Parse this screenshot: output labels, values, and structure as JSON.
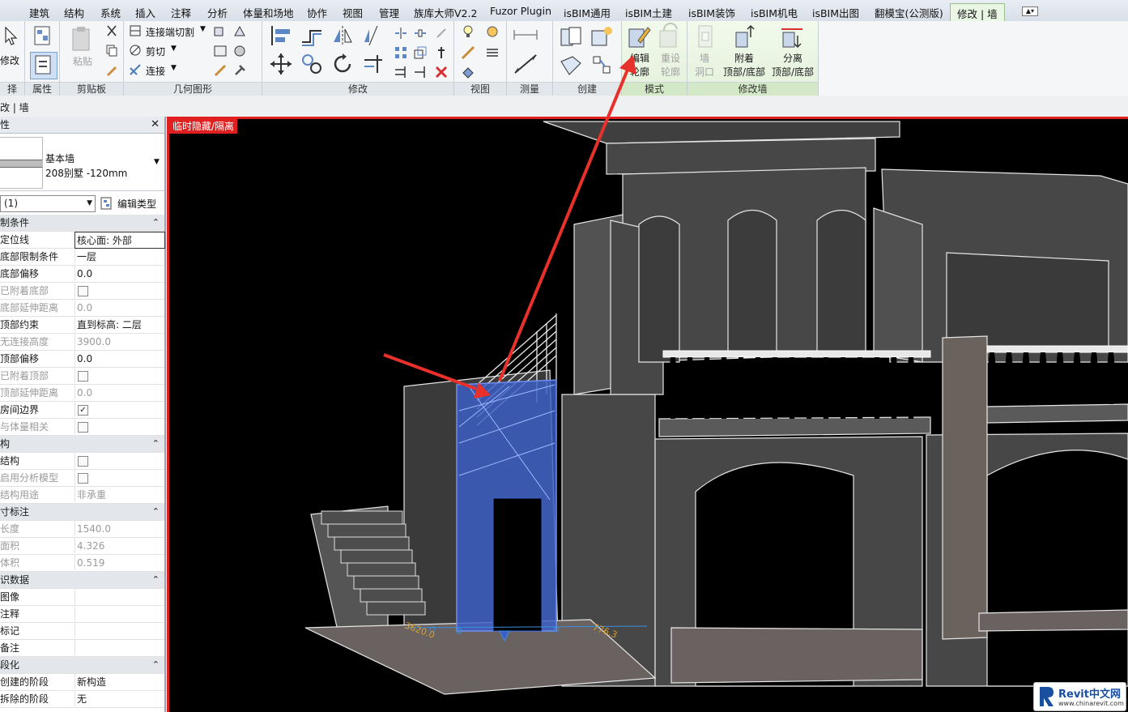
{
  "tabs": [
    "建筑",
    "结构",
    "系统",
    "插入",
    "注释",
    "分析",
    "体量和场地",
    "协作",
    "视图",
    "管理",
    "族库大师V2.2",
    "Fuzor Plugin",
    "isBIM通用",
    "isBIM土建",
    "isBIM装饰",
    "isBIM机电",
    "isBIM出图",
    "翻模宝(公测版)",
    "修改 | 墙"
  ],
  "ribbon": {
    "modify_label": "修改",
    "select_label": "择",
    "panels": {
      "select": "择",
      "properties": "属性",
      "clipboard": "剪贴板",
      "geometry": "几何图形",
      "modify": "修改",
      "view": "视图",
      "measure": "测量",
      "create": "创建",
      "mode": "模式",
      "modify_wall": "修改墙"
    },
    "paste_label": "粘贴",
    "geometry_items": [
      "连接端切割",
      "剪切",
      "连接"
    ],
    "edit_profile": "编辑\n轮廓",
    "reset_profile": "重设\n轮廓",
    "wall_opening": "墙\n洞口",
    "attach_top_base": "附着\n顶部/底部",
    "detach_top_base": "分离\n顶部/底部"
  },
  "options_bar": "改 | 墙",
  "properties": {
    "title": "性",
    "type_family": "基本墙",
    "type_name": "208别墅 -120mm",
    "filter": "(1)",
    "edit_type": "编辑类型",
    "rows": [
      {
        "group": true,
        "label": "制条件"
      },
      {
        "label": "定位线",
        "value": "核心面: 外部",
        "focus": true
      },
      {
        "label": "底部限制条件",
        "value": "一层"
      },
      {
        "label": "底部偏移",
        "value": "0.0"
      },
      {
        "label": "已附着底部",
        "check": false,
        "dim": true
      },
      {
        "label": "底部延伸距离",
        "value": "0.0",
        "dim": true
      },
      {
        "label": "顶部约束",
        "value": "直到标高: 二层"
      },
      {
        "label": "无连接高度",
        "value": "3900.0",
        "dim": true
      },
      {
        "label": "顶部偏移",
        "value": "0.0"
      },
      {
        "label": "已附着顶部",
        "check": false,
        "dim": true
      },
      {
        "label": "顶部延伸距离",
        "value": "0.0",
        "dim": true
      },
      {
        "label": "房间边界",
        "check": true
      },
      {
        "label": "与体量相关",
        "check": false,
        "dim": true
      },
      {
        "group": true,
        "label": "构"
      },
      {
        "label": "结构",
        "check": false
      },
      {
        "label": "启用分析模型",
        "check": false,
        "dim": true
      },
      {
        "label": "结构用途",
        "value": "非承重",
        "dim": true
      },
      {
        "group": true,
        "label": "寸标注"
      },
      {
        "label": "长度",
        "value": "1540.0",
        "dim": true
      },
      {
        "label": "面积",
        "value": "4.326",
        "dim": true
      },
      {
        "label": "体积",
        "value": "0.519",
        "dim": true
      },
      {
        "group": true,
        "label": "识数据"
      },
      {
        "label": "图像",
        "value": ""
      },
      {
        "label": "注释",
        "value": ""
      },
      {
        "label": "标记",
        "value": ""
      },
      {
        "label": "备注",
        "value": ""
      },
      {
        "group": true,
        "label": "段化"
      },
      {
        "label": "创建的阶段",
        "value": "新构造"
      },
      {
        "label": "拆除的阶段",
        "value": "无"
      }
    ]
  },
  "viewport": {
    "label": "临时隐藏/隔离",
    "dim_left": "3620.0",
    "dim_right": "776.3"
  },
  "watermark": {
    "brand": "Revit中文网",
    "url": "www.chinarevit.com"
  },
  "colors": {
    "accent_red": "#e02020",
    "selection_blue": "#3a5fc8",
    "ribbon_green": "#e3f1da"
  }
}
